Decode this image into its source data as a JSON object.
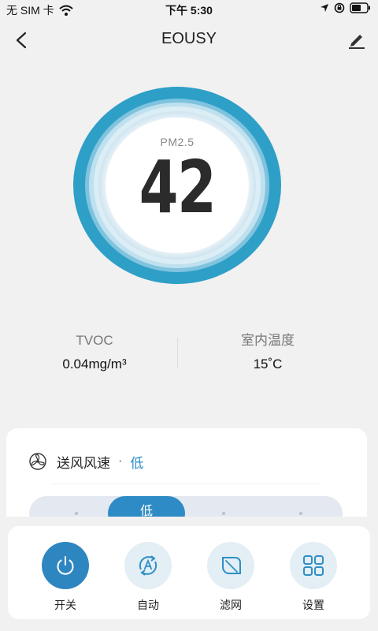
{
  "status_bar": {
    "carrier": "无 SIM 卡",
    "time": "下午 5:30"
  },
  "nav": {
    "title": "EOUSY"
  },
  "gauge": {
    "label": "PM2.5",
    "value": "42"
  },
  "metrics": [
    {
      "label": "TVOC",
      "value": "0.04mg/m³"
    },
    {
      "label": "室内温度",
      "value": "15˚C"
    }
  ],
  "fan_speed": {
    "title": "送风风速",
    "separator": "·",
    "current": "低",
    "options": [
      "低"
    ],
    "selected_index": 1,
    "position_count": 4
  },
  "bottom_bar": {
    "items": [
      {
        "label": "开关",
        "icon": "power-icon",
        "active": true
      },
      {
        "label": "自动",
        "icon": "auto-icon",
        "active": false
      },
      {
        "label": "滤网",
        "icon": "leaf-icon",
        "active": false
      },
      {
        "label": "设置",
        "icon": "grid-icon",
        "active": false
      }
    ]
  },
  "colors": {
    "accent": "#2E86C1",
    "gauge_ring": "#2E9FC7",
    "background": "#F1F1F1"
  }
}
